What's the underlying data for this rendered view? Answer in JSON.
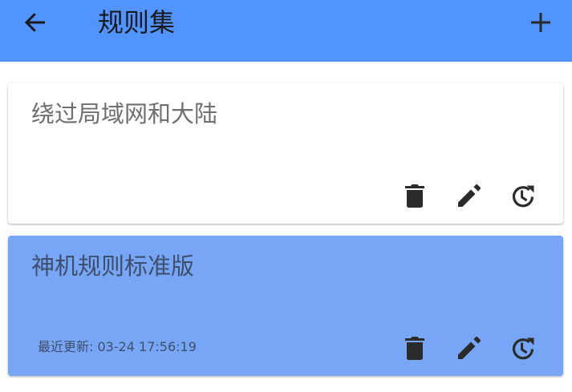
{
  "app_bar": {
    "title": "规则集",
    "back_icon": "arrow-left-icon",
    "add_icon": "plus-icon",
    "background": "#5294FF"
  },
  "rule_sets": [
    {
      "name": "绕过局域网和大陆",
      "last_updated": "",
      "selected": false,
      "background": "#ffffff"
    },
    {
      "name": "神机规则标准版",
      "last_updated": "最近更新: 03-24 17:56:19",
      "selected": true,
      "background": "#78A6F6"
    }
  ],
  "card_actions": [
    {
      "icon": "trash-icon"
    },
    {
      "icon": "pencil-icon"
    },
    {
      "icon": "history-update-icon"
    }
  ]
}
